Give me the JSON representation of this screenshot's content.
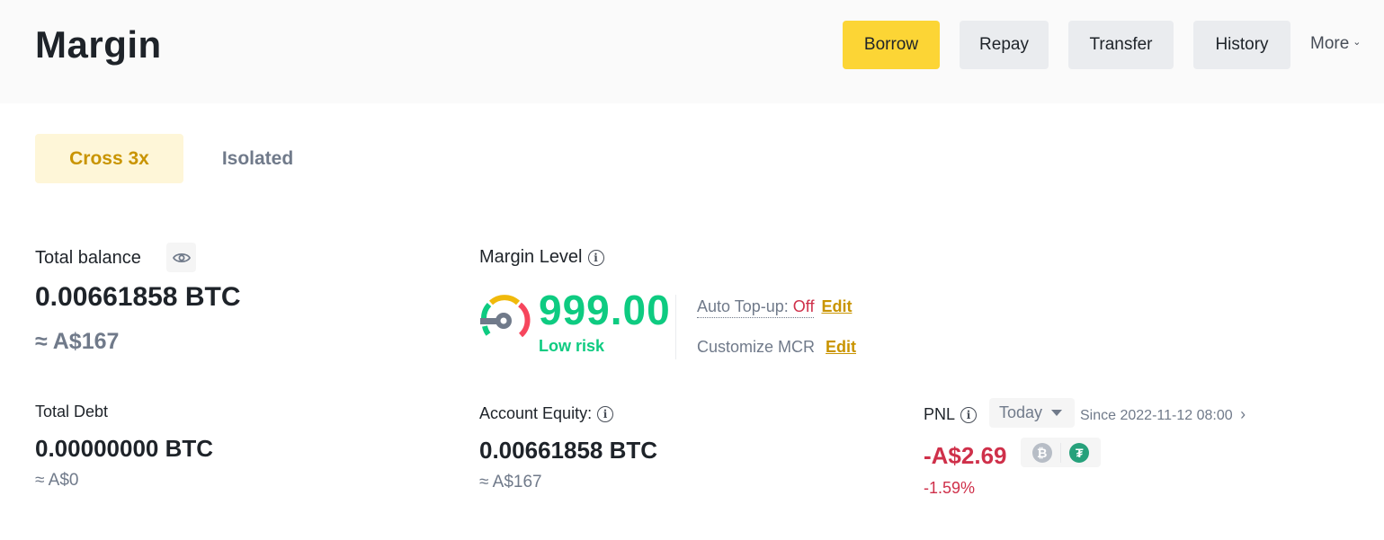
{
  "header": {
    "title": "Margin",
    "buttons": {
      "borrow": "Borrow",
      "repay": "Repay",
      "transfer": "Transfer",
      "history": "History",
      "more": "More"
    }
  },
  "tabs": [
    {
      "label": "Cross 3x",
      "active": true
    },
    {
      "label": "Isolated",
      "active": false
    }
  ],
  "total_balance": {
    "label": "Total balance",
    "value": "0.00661858 BTC",
    "fiat": "≈ A$167"
  },
  "total_debt": {
    "label": "Total Debt",
    "value": "0.00000000 BTC",
    "fiat": "≈ A$0"
  },
  "margin_level": {
    "label": "Margin Level",
    "value": "999.00",
    "risk": "Low risk",
    "auto_topup_label": "Auto Top-up:",
    "auto_topup_status": "Off",
    "edit_label": "Edit",
    "customize_mcr_label": "Customize MCR",
    "customize_edit_label": "Edit"
  },
  "account_equity": {
    "label": "Account Equity:",
    "value": "0.00661858 BTC",
    "fiat": "≈ A$167"
  },
  "pnl": {
    "label": "PNL",
    "period": "Today",
    "since": "Since 2022-11-12 08:00",
    "value": "-A$2.69",
    "percent": "-1.59%",
    "coins": [
      "BTC",
      "USDT"
    ]
  },
  "colors": {
    "accent": "#fcd535",
    "positive": "#0ecb81",
    "negative": "#cf304a",
    "link": "#c99400"
  }
}
